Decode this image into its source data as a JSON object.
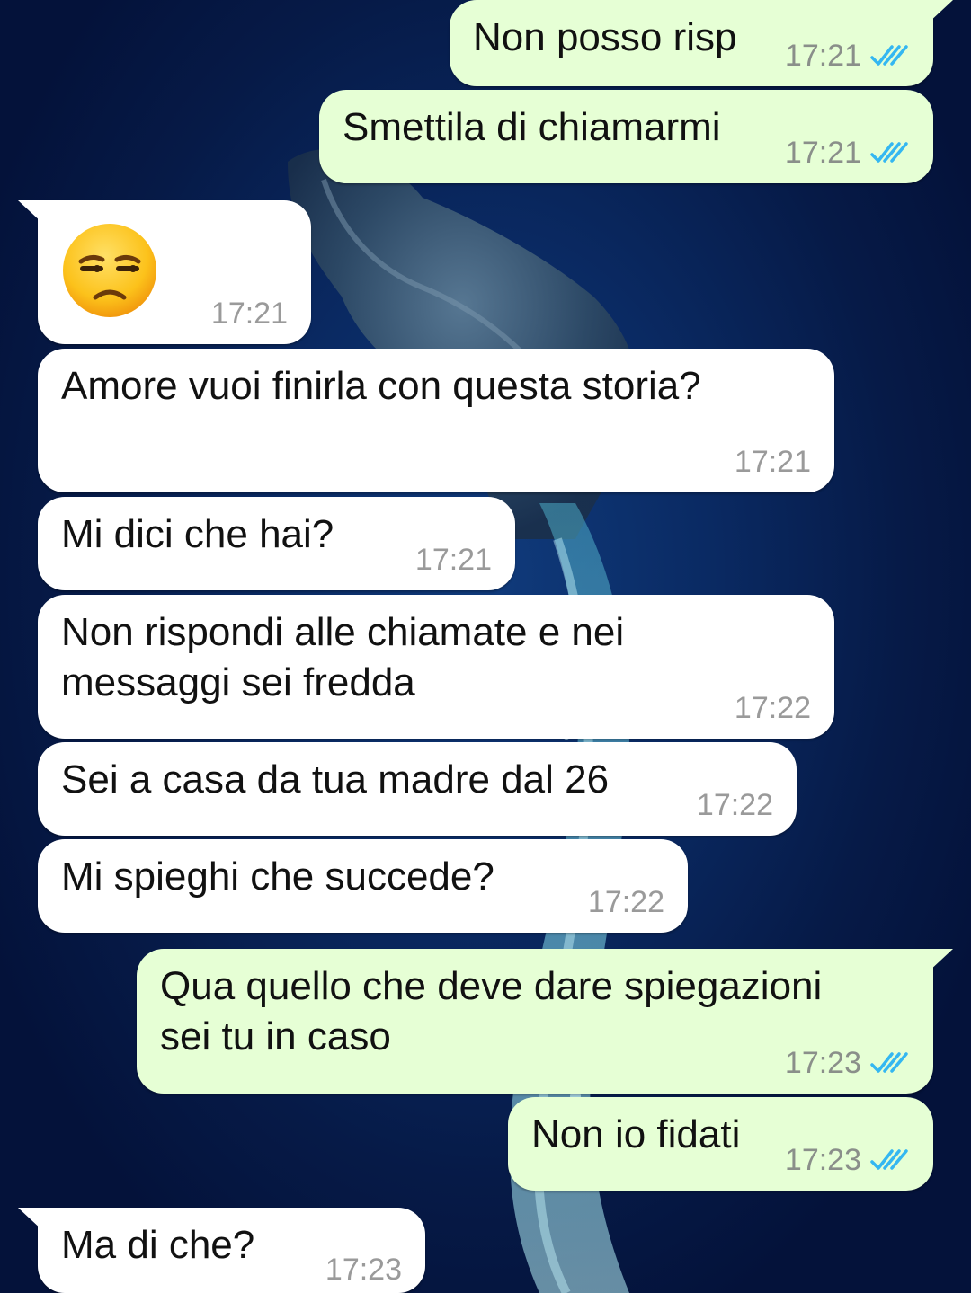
{
  "colors": {
    "outgoing_bubble": "#e6ffd5",
    "incoming_bubble": "#ffffff",
    "read_ticks": "#34b7f1",
    "timestamp": "#8a8f8a",
    "wallpaper": "#0a2a63"
  },
  "messages": [
    {
      "direction": "outgoing",
      "text": "Non posso risp",
      "time": "17:21",
      "status_icon": "double-check-read-icon"
    },
    {
      "direction": "outgoing",
      "text": "Smettila di chiamarmi",
      "time": "17:21",
      "status_icon": "double-check-read-icon"
    },
    {
      "direction": "incoming",
      "emoji": "unamused-face-emoji",
      "time": "17:21"
    },
    {
      "direction": "incoming",
      "text": "Amore vuoi finirla con questa storia?",
      "time": "17:21"
    },
    {
      "direction": "incoming",
      "text": "Mi dici che hai?",
      "time": "17:21"
    },
    {
      "direction": "incoming",
      "text": "Non rispondi alle chiamate e nei\nmessaggi sei fredda",
      "time": "17:22"
    },
    {
      "direction": "incoming",
      "text": "Sei a casa da tua madre dal 26",
      "time": "17:22"
    },
    {
      "direction": "incoming",
      "text": "Mi spieghi che succede?",
      "time": "17:22"
    },
    {
      "direction": "outgoing",
      "text": "Qua quello che deve dare spiegazioni\nsei tu in caso",
      "time": "17:23",
      "status_icon": "double-check-read-icon"
    },
    {
      "direction": "outgoing",
      "text": "Non io fidati",
      "time": "17:23",
      "status_icon": "double-check-read-icon"
    },
    {
      "direction": "incoming",
      "text": "Ma di che?",
      "time": "17:23"
    }
  ]
}
